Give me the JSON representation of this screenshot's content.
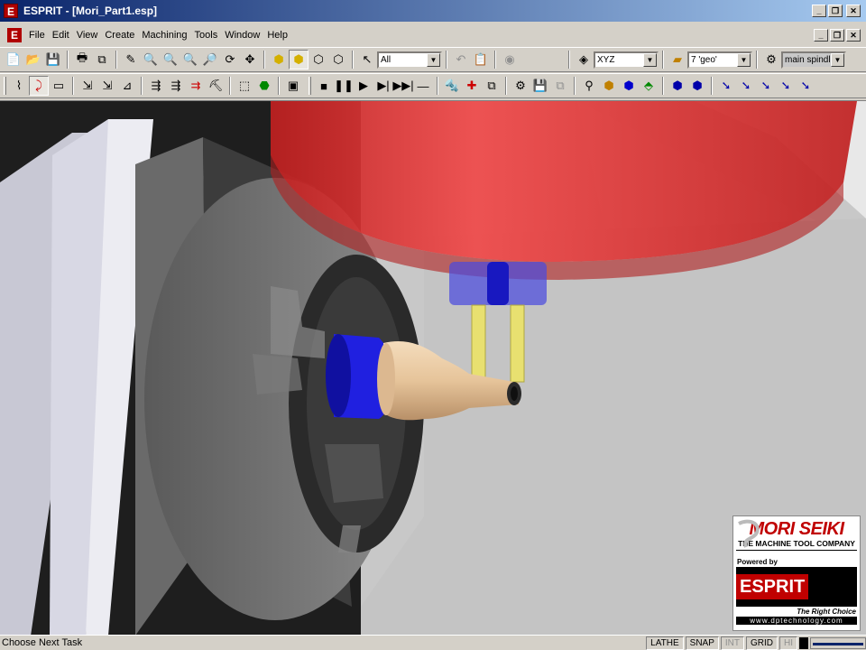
{
  "window": {
    "title": "ESPRIT - [Mori_Part1.esp]",
    "app_icon": "E"
  },
  "menu": {
    "items": [
      "File",
      "Edit",
      "View",
      "Create",
      "Machining",
      "Tools",
      "Window",
      "Help"
    ]
  },
  "toolbar1": {
    "filter_value": "All",
    "plane_value": "XYZ",
    "layer_value": "7 'geo'",
    "spindle_value": "main spindle"
  },
  "brand": {
    "maker": "MORI SEIKI",
    "tagline": "THE MACHINE TOOL COMPANY",
    "powered_by": "Powered by",
    "product": "ESPRIT",
    "slogan": "The Right Choice",
    "url": "www.dptechnology.com"
  },
  "status": {
    "message": "Choose Next Task",
    "modes": [
      "LATHE",
      "SNAP",
      "INT",
      "GRID",
      "HI"
    ],
    "inactive_modes": [
      "INT",
      "HI"
    ]
  },
  "colors": {
    "title_start": "#0a246a",
    "title_end": "#a6caf0",
    "brand_red": "#c00000",
    "spindle_red": "#e53030",
    "collet_blue": "#2020e0",
    "workpiece": "#e8c8a0",
    "tool_yellow": "#e8e070"
  }
}
